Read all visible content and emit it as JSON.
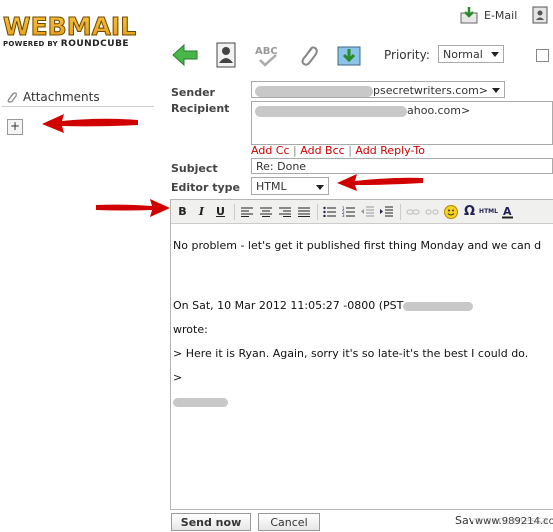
{
  "logo": {
    "main": "WEBMAIL",
    "sub_prefix": "POWERED BY ",
    "sub_brand": "ROUNDCUBE"
  },
  "header": {
    "email_nav_label": "E-Mail"
  },
  "toolbar": {
    "buttons": [
      "back-icon",
      "address-book-icon",
      "spellcheck-icon",
      "attach-icon",
      "save-icon"
    ],
    "spell_text": "ABC",
    "priority_label": "Priority:",
    "priority_value": "Normal"
  },
  "sidebar": {
    "title": "Attachments",
    "add_label": "+"
  },
  "form": {
    "sender_label": "Sender",
    "sender_value": "psecretwriters.com>",
    "recipient_label": "Recipient",
    "recipient_value": "ahoo.com>",
    "add_cc": "Add Cc",
    "add_bcc": "Add Bcc",
    "add_reply_to": "Add Reply-To",
    "separator": "|",
    "subject_label": "Subject",
    "subject_value": "Re: Done",
    "editor_label": "Editor type",
    "editor_value": "HTML"
  },
  "editor": {
    "body_line1": "No problem - let's get it published first thing Monday and we can d",
    "body_line2": "On Sat, 10 Mar 2012 11:05:27 -0800 (PST",
    "body_line3": "wrote:",
    "body_line4": "> Here it is Ryan. Again, sorry it's so late-it's the best I could do.",
    "body_line5": ">"
  },
  "footer": {
    "send_label": "Send now",
    "cancel_label": "Cancel",
    "save_sent_label": "Save sent messa",
    "watermark": "www.989214.com"
  },
  "colors": {
    "accent_red": "#cc0000",
    "link_red": "#cc0000"
  }
}
